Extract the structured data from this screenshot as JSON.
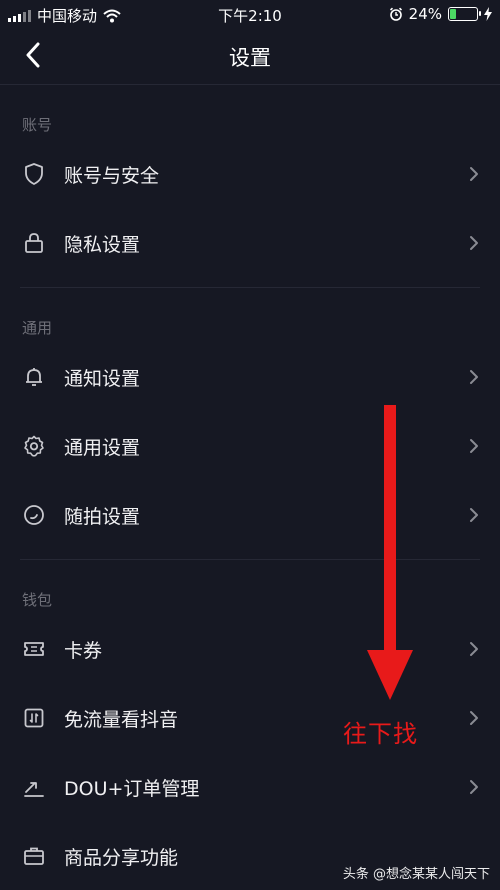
{
  "status_bar": {
    "carrier": "中国移动",
    "time": "下午2:10",
    "battery_percent": "24%",
    "battery_level": 0.24,
    "icons": [
      "signal-icon",
      "wifi-icon",
      "alarm-icon",
      "battery-icon",
      "charging-icon"
    ]
  },
  "nav": {
    "title": "设置",
    "back_icon": "chevron-left-icon"
  },
  "sections": [
    {
      "header": "账号",
      "items": [
        {
          "label": "账号与安全",
          "icon": "shield-icon"
        },
        {
          "label": "隐私设置",
          "icon": "lock-icon"
        }
      ]
    },
    {
      "header": "通用",
      "items": [
        {
          "label": "通知设置",
          "icon": "bell-icon"
        },
        {
          "label": "通用设置",
          "icon": "gear-icon"
        },
        {
          "label": "随拍设置",
          "icon": "camera-dial-icon"
        }
      ]
    },
    {
      "header": "钱包",
      "items": [
        {
          "label": "卡券",
          "icon": "ticket-icon"
        },
        {
          "label": "免流量看抖音",
          "icon": "data-free-icon"
        },
        {
          "label": "DOU+订单管理",
          "icon": "trend-icon"
        },
        {
          "label": "商品分享功能",
          "icon": "briefcase-icon"
        }
      ]
    }
  ],
  "annotation": {
    "text": "往下找",
    "color": "#e81a1a"
  },
  "watermark": {
    "brand": "头条",
    "text": "@想念某某人闯天下"
  },
  "colors": {
    "background": "#161823",
    "accent_annotation": "#e81a1a",
    "battery_fill": "#4cd964"
  }
}
